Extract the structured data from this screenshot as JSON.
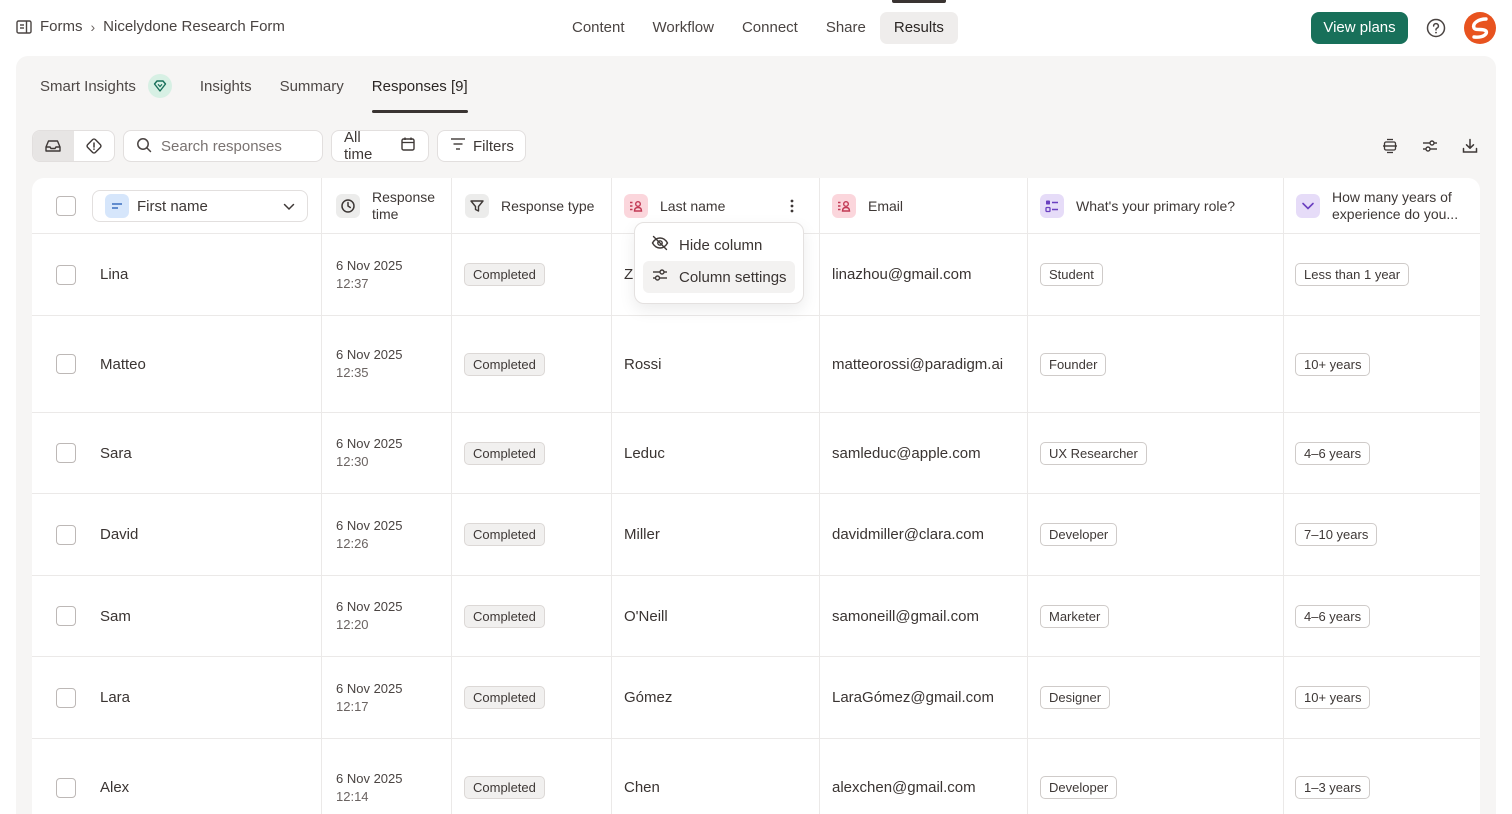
{
  "breadcrumb": {
    "root": "Forms",
    "current": "Nicelydone Research Form"
  },
  "topnav": [
    "Content",
    "Workflow",
    "Connect",
    "Share",
    "Results"
  ],
  "topnav_active": "Results",
  "actions": {
    "view_plans": "View plans",
    "help_icon": "help-circle-icon",
    "brand_icon": "brand-logo"
  },
  "tabs": [
    "Smart Insights",
    "Insights",
    "Summary",
    "Responses [9]"
  ],
  "tabs_active": "Responses [9]",
  "toolbar": {
    "search_placeholder": "Search responses",
    "date_filter": "All time",
    "filters": "Filters",
    "right_icons": [
      "row-height-icon",
      "column-settings-icon",
      "download-icon"
    ]
  },
  "columns": {
    "first_name": "First name",
    "response_time": "Response time",
    "response_type": "Response type",
    "last_name": "Last name",
    "email": "Email",
    "role": "What's your primary role?",
    "experience": "How many years of experience do you..."
  },
  "column_menu": {
    "hide": "Hide column",
    "settings": "Column settings"
  },
  "rows": [
    {
      "first": "Lina",
      "date": "6 Nov 2025",
      "time": "12:37",
      "type": "Completed",
      "last": "Zhou",
      "email": "linazhou@gmail.com",
      "role": "Student",
      "exp": "Less than 1 year"
    },
    {
      "first": "Matteo",
      "date": "6 Nov 2025",
      "time": "12:35",
      "type": "Completed",
      "last": "Rossi",
      "email": "matteorossi@paradigm.ai",
      "role": "Founder",
      "exp": "10+ years"
    },
    {
      "first": "Sara",
      "date": "6 Nov 2025",
      "time": "12:30",
      "type": "Completed",
      "last": "Leduc",
      "email": "samleduc@apple.com",
      "role": "UX Researcher",
      "exp": "4–6 years"
    },
    {
      "first": "David",
      "date": "6 Nov 2025",
      "time": "12:26",
      "type": "Completed",
      "last": "Miller",
      "email": "davidmiller@clara.com",
      "role": "Developer",
      "exp": "7–10 years"
    },
    {
      "first": "Sam",
      "date": "6 Nov 2025",
      "time": "12:20",
      "type": "Completed",
      "last": "O'Neill",
      "email": "samoneill@gmail.com",
      "role": "Marketer",
      "exp": "4–6 years"
    },
    {
      "first": "Lara",
      "date": "6 Nov 2025",
      "time": "12:17",
      "type": "Completed",
      "last": "Gómez",
      "email": "LaraGómez@gmail.com",
      "role": "Designer",
      "exp": "10+ years"
    },
    {
      "first": "Alex",
      "date": "6 Nov 2025",
      "time": "12:14",
      "type": "Completed",
      "last": "Chen",
      "email": "alexchen@gmail.com",
      "role": "Developer",
      "exp": "1–3 years"
    }
  ],
  "colors": {
    "primary": "#18705a",
    "brand": "#e8531f",
    "contact_icon_bg": "#fbd6dc",
    "choice_icon_bg": "#e6dcf8",
    "field_icon_bg": "#d6e6fb"
  }
}
